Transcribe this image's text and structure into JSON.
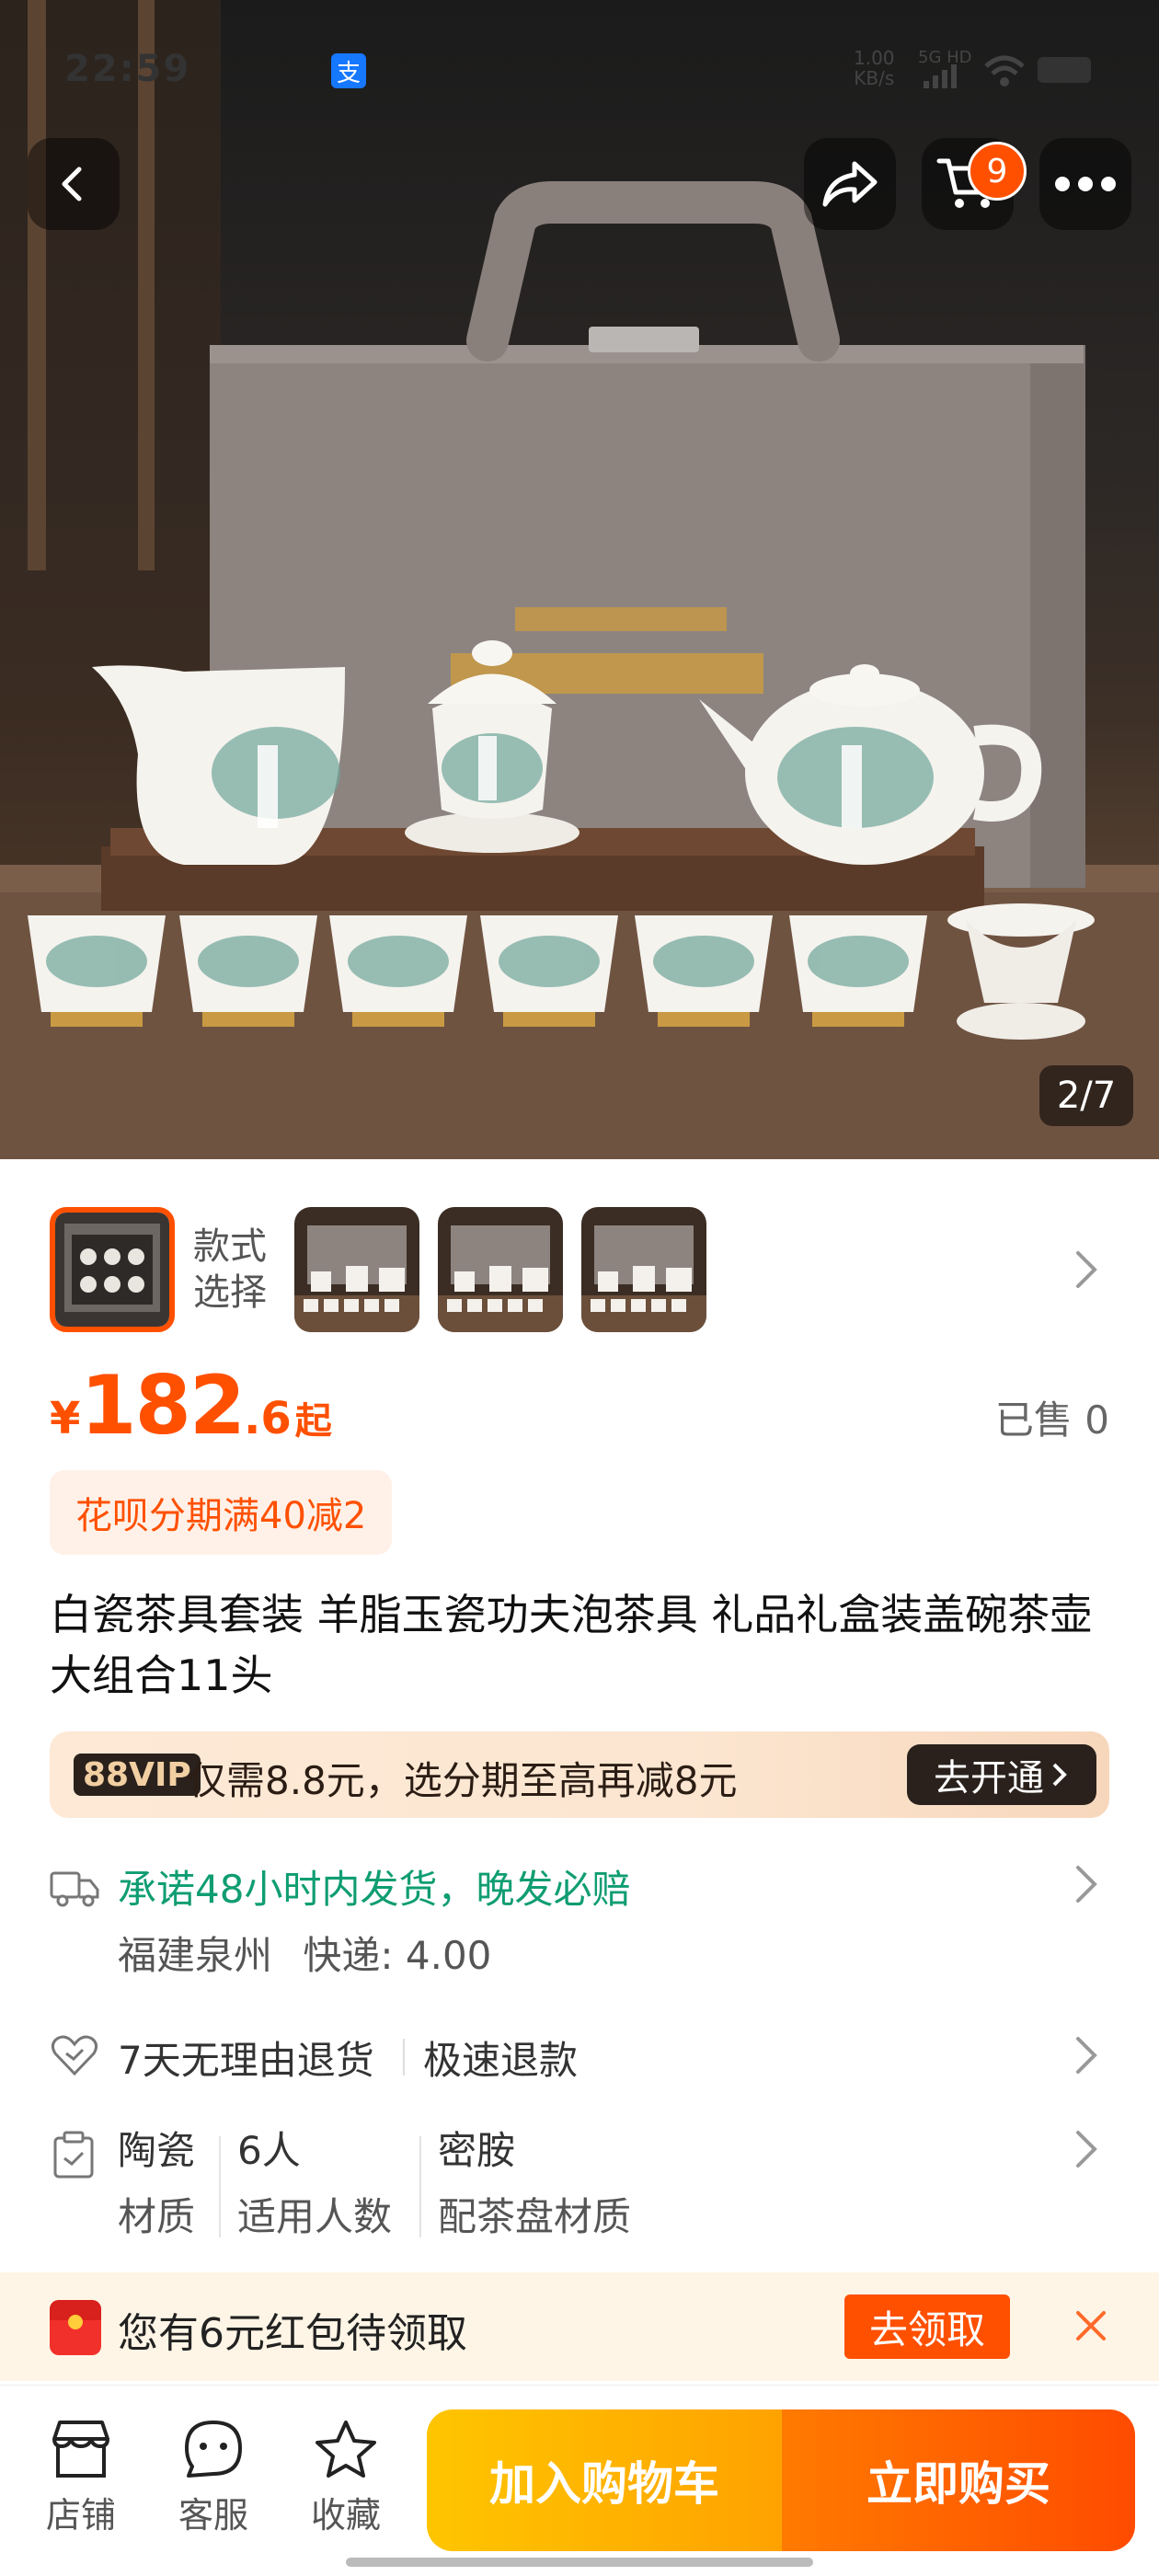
{
  "status_bar": {
    "time": "22:59",
    "net_speed_value": "1.00",
    "net_speed_unit": "KB/s",
    "network": "5G HD"
  },
  "header": {
    "cart_count": "9"
  },
  "gallery": {
    "counter": "2/7"
  },
  "variants": {
    "label": "款式\n选择"
  },
  "price": {
    "currency": "¥",
    "integer": "182",
    "decimal": ".6",
    "suffix": "起",
    "sold": "已售 0"
  },
  "promo": {
    "text": "花呗分期满40减2"
  },
  "product": {
    "title": "白瓷茶具套装 羊脂玉瓷功夫泡茶具 礼品礼盒装盖碗茶壶大组合11头"
  },
  "vip": {
    "badge": "88VIP",
    "text": "仅需8.8元，选分期至高再减8元",
    "button": "去开通"
  },
  "shipping": {
    "promise": "承诺48小时内发货，晚发必赔",
    "origin": "福建泉州",
    "fee": "快递: 4.00"
  },
  "returns": {
    "policy": "7天无理由退货",
    "refund": "极速退款"
  },
  "attributes": [
    {
      "value": "陶瓷",
      "key": "材质"
    },
    {
      "value": "6人",
      "key": "适用人数"
    },
    {
      "value": "密胺",
      "key": "配茶盘材质"
    }
  ],
  "coupon": {
    "text": "您有6元红包待领取",
    "button": "去领取"
  },
  "bottom_bar": {
    "shop": "店铺",
    "service": "客服",
    "favorite": "收藏",
    "add_to_cart": "加入购物车",
    "buy_now": "立即购买"
  },
  "colors": {
    "accent": "#ff5000",
    "green": "#0f9d72"
  }
}
